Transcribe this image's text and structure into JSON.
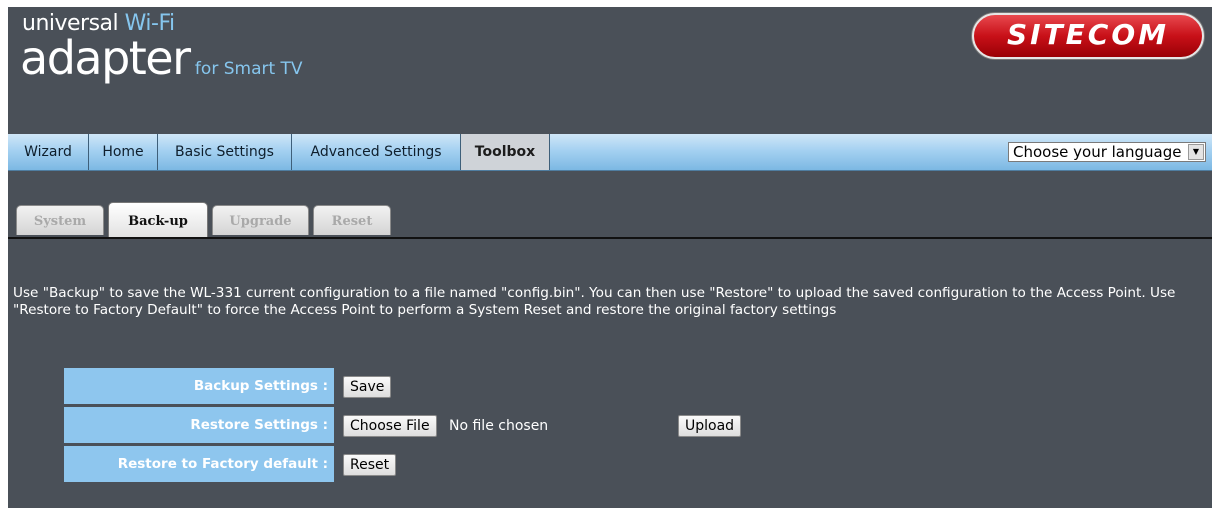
{
  "header": {
    "logo_line1_a": "universal",
    "logo_line1_b": " Wi-Fi",
    "logo_line2_a": "adapter",
    "logo_line2_b": " for Smart TV",
    "brand": "SITECOM"
  },
  "menu": {
    "items": [
      {
        "label": "Wizard"
      },
      {
        "label": "Home"
      },
      {
        "label": "Basic Settings"
      },
      {
        "label": "Advanced Settings"
      },
      {
        "label": "Toolbox",
        "active": true
      }
    ],
    "language_select": {
      "value": "Choose your language"
    }
  },
  "subtabs": [
    {
      "label": "System"
    },
    {
      "label": "Back-up",
      "active": true
    },
    {
      "label": "Upgrade"
    },
    {
      "label": "Reset"
    }
  ],
  "description": "Use \"Backup\" to save the WL-331 current configuration to a file named \"config.bin\". You can then use \"Restore\" to upload the saved configuration to the Access Point. Use \"Restore to Factory Default\" to force the Access Point to perform a System Reset and restore the original factory settings",
  "backup": {
    "label": "Backup Settings :",
    "save_button": "Save"
  },
  "restore": {
    "label": "Restore Settings :",
    "choose_file_button": "Choose File",
    "file_status": "No file chosen",
    "upload_button": "Upload"
  },
  "factory": {
    "label": "Restore to Factory default :",
    "reset_button": "Reset"
  },
  "colors": {
    "background": "#4a5058",
    "menu_bar": "#a5d1f1",
    "label_cell": "#8ec6ee",
    "brand_red": "#c81018",
    "logo_accent": "#86c6ee"
  }
}
